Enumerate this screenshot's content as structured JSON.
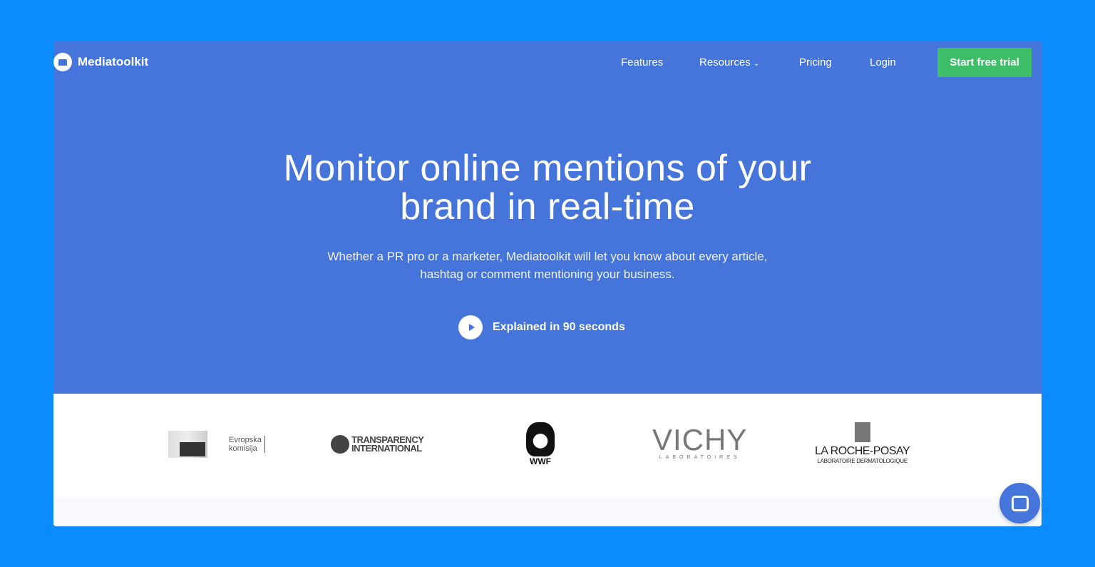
{
  "brand": {
    "name": "Mediatoolkit"
  },
  "nav": {
    "items": [
      "Features",
      "Resources",
      "Pricing",
      "Login"
    ],
    "cta": "Start free trial"
  },
  "hero": {
    "title_line1": "Monitor online mentions of your",
    "title_line2": "brand in real-time",
    "subtitle_line1": "Whether a PR pro or a marketer, Mediatoolkit will let you know about every article,",
    "subtitle_line2": "hashtag or comment mentioning your business.",
    "video_label": "Explained in 90 seconds"
  },
  "logos": {
    "eu_line1": "Evropska",
    "eu_line2": "komisija",
    "ti_line1": "TRANSPARENCY",
    "ti_line2": "INTERNATIONAL",
    "wwf": "WWF",
    "vichy": "VICHY",
    "vichy_sub": "LABORATOIRES",
    "lrp": "LA ROCHE-POSAY",
    "lrp_sub": "LABORATOIRE DERMATOLOGIQUE"
  },
  "colors": {
    "background": "#0b8bfd",
    "hero": "#4575db",
    "cta": "#3fbe6a"
  }
}
